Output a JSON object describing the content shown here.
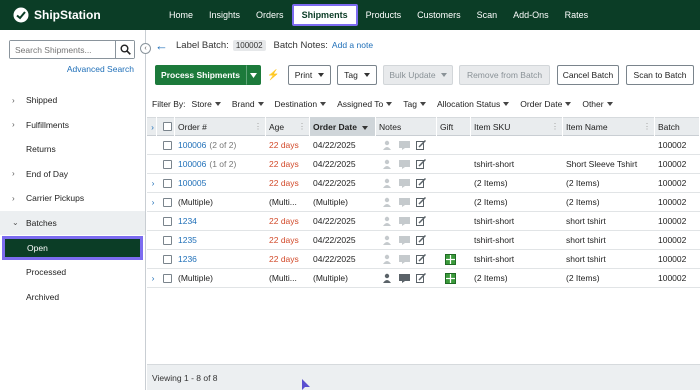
{
  "brand": {
    "name": "ShipStation"
  },
  "topnav": {
    "items": [
      {
        "label": "Home"
      },
      {
        "label": "Insights"
      },
      {
        "label": "Orders"
      },
      {
        "label": "Shipments"
      },
      {
        "label": "Products"
      },
      {
        "label": "Customers"
      },
      {
        "label": "Scan"
      },
      {
        "label": "Add-Ons"
      },
      {
        "label": "Rates"
      }
    ],
    "active": "Shipments"
  },
  "sidebar": {
    "search_placeholder": "Search Shipments...",
    "advanced_search": "Advanced Search",
    "items": [
      {
        "label": "Shipped"
      },
      {
        "label": "Fulfillments"
      },
      {
        "label": "Returns"
      },
      {
        "label": "End of Day"
      },
      {
        "label": "Carrier Pickups"
      },
      {
        "label": "Batches"
      }
    ],
    "batch_items": [
      {
        "label": "Open"
      },
      {
        "label": "Processed"
      },
      {
        "label": "Archived"
      }
    ]
  },
  "batch": {
    "label": "Label Batch:",
    "number": "100002",
    "notes_label": "Batch Notes:",
    "add_note": "Add a note"
  },
  "actions": {
    "process": "Process Shipments",
    "print": "Print",
    "tag": "Tag",
    "bulk_update": "Bulk Update",
    "remove": "Remove from Batch",
    "cancel": "Cancel Batch",
    "scan": "Scan to Batch"
  },
  "filters": {
    "label": "Filter By:",
    "items": [
      {
        "label": "Store"
      },
      {
        "label": "Brand"
      },
      {
        "label": "Destination"
      },
      {
        "label": "Assigned To"
      },
      {
        "label": "Tag"
      },
      {
        "label": "Allocation Status"
      },
      {
        "label": "Order Date"
      },
      {
        "label": "Other"
      }
    ]
  },
  "table": {
    "columns": {
      "order": "Order #",
      "age": "Age",
      "order_date": "Order Date",
      "notes": "Notes",
      "gift": "Gift",
      "sku": "Item SKU",
      "item_name": "Item Name",
      "batch": "Batch"
    },
    "rows": [
      {
        "order": "100006",
        "order_suffix": "(2 of 2)",
        "age": "22 days",
        "date": "04/22/2025",
        "sku": "",
        "item": "",
        "batch": "100002",
        "expand": false,
        "gift": false,
        "note_dark": false,
        "red": true,
        "link": true
      },
      {
        "order": "100006",
        "order_suffix": "(1 of 2)",
        "age": "22 days",
        "date": "04/22/2025",
        "sku": "tshirt-short",
        "item": "Short Sleeve Tshirt",
        "batch": "100002",
        "expand": false,
        "gift": false,
        "note_dark": false,
        "red": true,
        "link": true
      },
      {
        "order": "100005",
        "order_suffix": "",
        "age": "22 days",
        "date": "04/22/2025",
        "sku": "(2 Items)",
        "item": "(2 Items)",
        "batch": "100002",
        "expand": true,
        "gift": false,
        "note_dark": false,
        "red": true,
        "link": true
      },
      {
        "order": "(Multiple)",
        "order_suffix": "",
        "age": "(Multi...",
        "date": "(Multiple)",
        "sku": "(2 Items)",
        "item": "(2 Items)",
        "batch": "100002",
        "expand": true,
        "gift": false,
        "note_dark": false,
        "red": false,
        "link": false
      },
      {
        "order": "1234",
        "order_suffix": "",
        "age": "22 days",
        "date": "04/22/2025",
        "sku": "tshirt-short",
        "item": "short tshirt",
        "batch": "100002",
        "expand": false,
        "gift": false,
        "note_dark": false,
        "red": true,
        "link": true
      },
      {
        "order": "1235",
        "order_suffix": "",
        "age": "22 days",
        "date": "04/22/2025",
        "sku": "tshirt-short",
        "item": "short tshirt",
        "batch": "100002",
        "expand": false,
        "gift": false,
        "note_dark": false,
        "red": true,
        "link": true
      },
      {
        "order": "1236",
        "order_suffix": "",
        "age": "22 days",
        "date": "04/22/2025",
        "sku": "tshirt-short",
        "item": "short tshirt",
        "batch": "100002",
        "expand": false,
        "gift": true,
        "note_dark": false,
        "red": true,
        "link": true
      },
      {
        "order": "(Multiple)",
        "order_suffix": "",
        "age": "(Multi...",
        "date": "(Multiple)",
        "sku": "(2 Items)",
        "item": "(2 Items)",
        "batch": "100002",
        "expand": true,
        "gift": true,
        "note_dark": true,
        "red": false,
        "link": false
      }
    ]
  },
  "footer": {
    "viewing": "Viewing 1 - 8 of 8"
  },
  "colors": {
    "nav_bg": "#0b3d26",
    "primary": "#1c7a3b",
    "link": "#1f6fb8",
    "highlight": "#7c6cf0",
    "age_red": "#d24a2a"
  }
}
